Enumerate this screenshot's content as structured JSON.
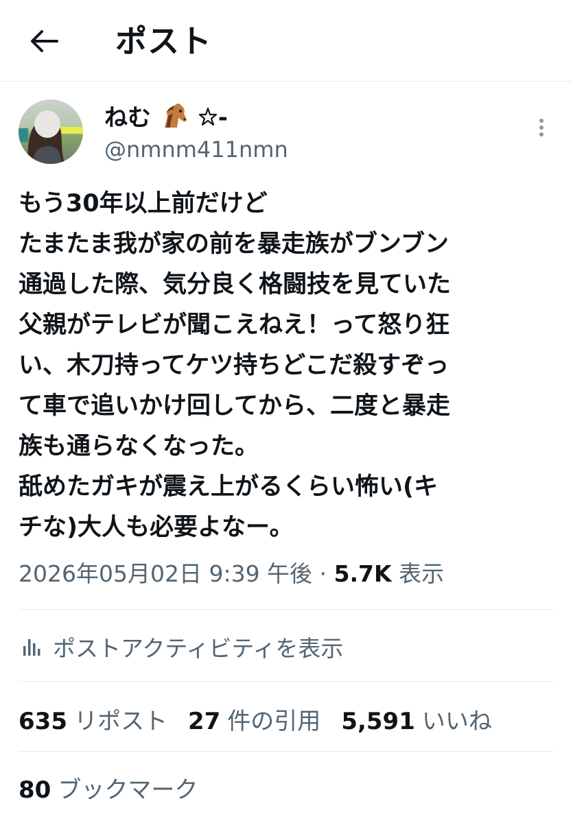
{
  "header": {
    "title": "ポスト",
    "back_icon": "arrow-left-icon"
  },
  "author": {
    "display_name": "ねむ",
    "name_emojis": "🐴✴︎-",
    "handle": "@nmnm411nmn",
    "avatar_icon": "user-avatar"
  },
  "tweet": {
    "text": "もう30年以上前だけど\nたまたま我が家の前を暴走族がブンブン\n通過した際、気分良く格闘技を見ていた\n父親がテレビが聞こえねえ！って怒り狂\nい、木刀持ってケツ持ちどこだ殺すぞっ\nて車で追いかけ回してから、二度と暴走\n族も通らなくなった。\n舐めたガキが震え上がるくらい怖い(キ\nチな)大人も必要よなー。"
  },
  "meta": {
    "timestamp": "2026年05月02日 9:39 午後",
    "separator": "·",
    "views_count": "5.7K",
    "views_label": "表示"
  },
  "activity": {
    "label": "ポストアクティビティを表示",
    "icon": "bar-chart-icon"
  },
  "stats": {
    "reposts_count": "635",
    "reposts_label": "リポスト",
    "quotes_count": "27",
    "quotes_label": "件の引用",
    "likes_count": "5,591",
    "likes_label": "いいね",
    "bookmarks_count": "80",
    "bookmarks_label": "ブックマーク"
  },
  "more_icon": "more-vertical-icon",
  "colors": {
    "text_primary": "#0f1419",
    "text_secondary": "#536471",
    "divider": "#e6e9eb"
  }
}
